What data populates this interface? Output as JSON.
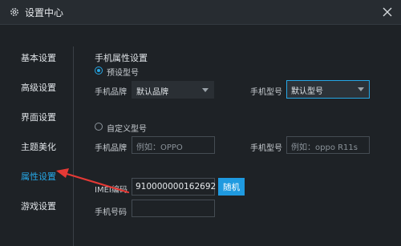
{
  "window": {
    "title": "设置中心"
  },
  "sidebar": {
    "items": [
      {
        "label": "基本设置",
        "active": false
      },
      {
        "label": "高级设置",
        "active": false
      },
      {
        "label": "界面设置",
        "active": false
      },
      {
        "label": "主题美化",
        "active": false
      },
      {
        "label": "属性设置",
        "active": true
      },
      {
        "label": "游戏设置",
        "active": false
      }
    ]
  },
  "content": {
    "section_title": "手机属性设置",
    "preset": {
      "radio_label": "预设型号",
      "checked": true,
      "brand_label": "手机品牌",
      "brand_value": "默认品牌",
      "model_label": "手机型号",
      "model_value": "默认型号"
    },
    "custom": {
      "radio_label": "自定义型号",
      "checked": false,
      "brand_label": "手机品牌",
      "brand_placeholder": "例如：OPPO",
      "model_label": "手机型号",
      "model_placeholder": "例如：oppo R11s"
    },
    "imei": {
      "label": "IMEI编码",
      "value": "910000000162692",
      "random_button": "随机"
    },
    "phone": {
      "label": "手机号码",
      "value": ""
    }
  },
  "colors": {
    "accent": "#26a7e6",
    "annotation_arrow": "#e53935",
    "background": "#1e2226"
  },
  "icons": {
    "title": "gear-icon",
    "close": "close-icon"
  }
}
